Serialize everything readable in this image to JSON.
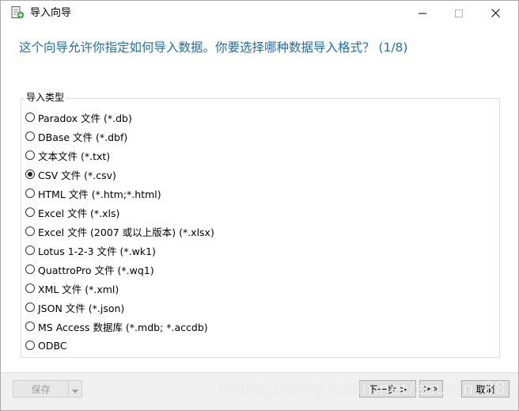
{
  "window": {
    "title": "导入向导",
    "controls": {
      "minimize_icon": "minimize-icon",
      "maximize_icon": "maximize-icon",
      "close_icon": "close-icon"
    }
  },
  "prompt": "这个向导允许你指定如何导入数据。你要选择哪种数据导入格式？ (1/8)",
  "import_type": {
    "legend": "导入类型",
    "options": [
      {
        "label": "Paradox 文件 (*.db)",
        "selected": false
      },
      {
        "label": "DBase 文件 (*.dbf)",
        "selected": false
      },
      {
        "label": "文本文件 (*.txt)",
        "selected": false
      },
      {
        "label": "CSV 文件 (*.csv)",
        "selected": true
      },
      {
        "label": "HTML 文件 (*.htm;*.html)",
        "selected": false
      },
      {
        "label": "Excel 文件 (*.xls)",
        "selected": false
      },
      {
        "label": "Excel 文件 (2007 或以上版本) (*.xlsx)",
        "selected": false
      },
      {
        "label": "Lotus 1-2-3 文件 (*.wk1)",
        "selected": false
      },
      {
        "label": "QuattroPro 文件 (*.wq1)",
        "selected": false
      },
      {
        "label": "XML 文件 (*.xml)",
        "selected": false
      },
      {
        "label": "JSON 文件 (*.json)",
        "selected": false
      },
      {
        "label": "MS Access 数据库 (*.mdb; *.accdb)",
        "selected": false
      },
      {
        "label": "ODBC",
        "selected": false
      }
    ]
  },
  "footer": {
    "save_label": "保存",
    "next_label": "下一步 >",
    "last_label": ">>",
    "cancel_label": "取消"
  },
  "watermark": "https://blog.csdn.net/zouxin_88",
  "colors": {
    "prompt": "#1a6fb3",
    "footer_bg": "#f0f0f0",
    "button_bg": "#e1e1e1"
  }
}
